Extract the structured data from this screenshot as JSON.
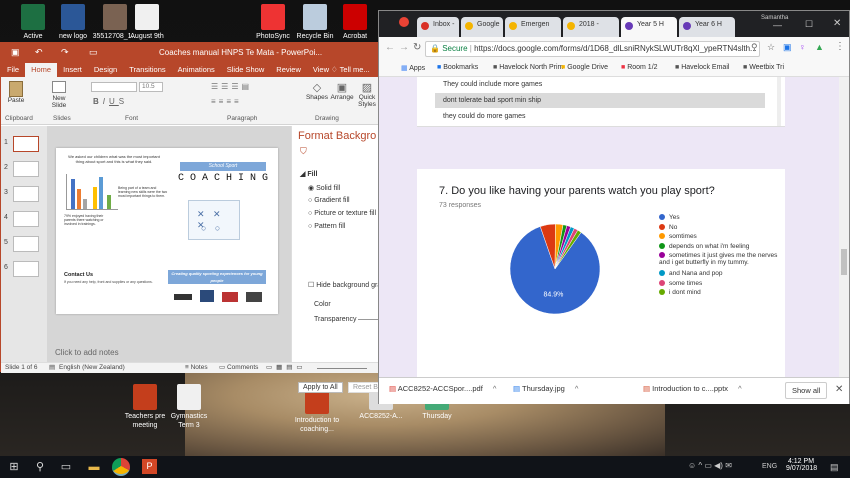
{
  "desktop": {
    "icons": [
      {
        "label": "Active",
        "color": "#1d6f42"
      },
      {
        "label": "new logo",
        "color": "#2b5797"
      },
      {
        "label": "35512708_1...",
        "color": "#7a6252"
      },
      {
        "label": "August 9th",
        "color": "#f0f0f0"
      },
      {
        "label": "PhotoSync",
        "color": "#e33"
      },
      {
        "label": "Recycle Bin",
        "color": "#bcd"
      },
      {
        "label": "Acrobat",
        "color": "#c00"
      }
    ],
    "bottom_icons": [
      {
        "label": "Teachers pre meeting",
        "color": "#c43e1c"
      },
      {
        "label": "Gymnastics Term 3",
        "color": "#f0f0f0"
      },
      {
        "label": "Introduction to coaching...",
        "color": "#c43e1c"
      },
      {
        "label": "ACC8252-A...",
        "color": "#ddd"
      },
      {
        "label": "Thursday",
        "color": "#4a7"
      }
    ]
  },
  "taskbar": {
    "time": "4:12 PM",
    "date": "9/07/2018",
    "lang": "ENG"
  },
  "ppt": {
    "title": "Coaches manual HNPS Te Mata - PowerPoi...",
    "tell_me": "Tell me...",
    "tabs": [
      "File",
      "Home",
      "Insert",
      "Design",
      "Transitions",
      "Animations",
      "Slide Show",
      "Review",
      "View"
    ],
    "ribbon": {
      "paste": "Paste",
      "new_slide": "New Slide",
      "font_size": "10.5",
      "shapes": "Shapes",
      "arrange": "Arrange",
      "quick_styles": "Quick Styles",
      "groups": [
        "Clipboard",
        "Slides",
        "Font",
        "Paragraph",
        "Drawing"
      ]
    },
    "slide_numbers": [
      "1",
      "2",
      "3",
      "4",
      "5",
      "6"
    ],
    "slide": {
      "intro": "We asked our children what was the most important thing about sport and this is what they said.",
      "banner": "School Sport",
      "big": "C O A C H I N G",
      "note": "Being part of a team and learning new skills were the two most important things to them.",
      "pct": "79% enjoyed having their parents there watching or involved in trainings.",
      "contact": "Contact Us",
      "contact_sub": "If you need any help, front and supplies or any questions.",
      "tagline": "Creating quality sporting experiences for young people"
    },
    "notes_placeholder": "Click to add notes",
    "format_pane": {
      "title": "Format Backgro",
      "section": "Fill",
      "options": [
        "Solid fill",
        "Gradient fill",
        "Picture or texture fill",
        "Pattern fill"
      ],
      "hide": "Hide background gra",
      "color": "Color",
      "transparency": "Transparency",
      "apply": "Apply to All",
      "reset": "Reset Bac"
    },
    "status": {
      "slide": "Slide 1 of 6",
      "lang": "English (New Zealand)",
      "notes": "Notes",
      "comments": "Comments"
    }
  },
  "chrome": {
    "profile": "Samantha",
    "tabs": [
      {
        "label": "Inbox -",
        "color": "#d93025"
      },
      {
        "label": "Google",
        "color": "#f4b400"
      },
      {
        "label": "Emergen",
        "color": "#f4b400"
      },
      {
        "label": "2018 -",
        "color": "#f4b400"
      },
      {
        "label": "Year 5 H",
        "color": "#673ab7"
      },
      {
        "label": "Year 6 H",
        "color": "#673ab7"
      }
    ],
    "secure": "Secure",
    "url": "https://docs.google.com/forms/d/1D68_dlLsniRNykSLWUTr8qXl_ypeRTN4slth...",
    "bookmarks": [
      "Apps",
      "Bookmarks",
      "Havelock North Prim",
      "Google Drive",
      "Room 1/2",
      "Havelock Email",
      "Weetbix Tri"
    ],
    "answers": [
      "They could include more games",
      "dont tolerate bad sport min ship",
      "they could do more games"
    ],
    "question": "7. Do you like having your parents watch you play sport?",
    "responses": "73 responses"
  },
  "chart_data": {
    "type": "pie",
    "series": [
      {
        "name": "Yes",
        "value": 84.9,
        "color": "#3366cc"
      },
      {
        "name": "No",
        "value": 5.5,
        "color": "#dc3912"
      },
      {
        "name": "somtimes",
        "value": 2.7,
        "color": "#ff9900"
      },
      {
        "name": "depends on what i'm feeling",
        "value": 1.4,
        "color": "#109618"
      },
      {
        "name": "sometimes it just gives me the nerves and i get butterfly in my tummy.",
        "value": 1.4,
        "color": "#990099"
      },
      {
        "name": "and Nana and pop",
        "value": 1.4,
        "color": "#0099c6"
      },
      {
        "name": "some times",
        "value": 1.4,
        "color": "#dd4477"
      },
      {
        "name": "i dont mind",
        "value": 1.4,
        "color": "#66aa00"
      }
    ],
    "data_labels": [
      "84.9%"
    ],
    "legend": "right"
  },
  "downloads": {
    "items": [
      "ACC8252-ACCSpor....pdf",
      "Thursday.jpg",
      "Introduction to c....pptx"
    ],
    "show_all": "Show all"
  }
}
